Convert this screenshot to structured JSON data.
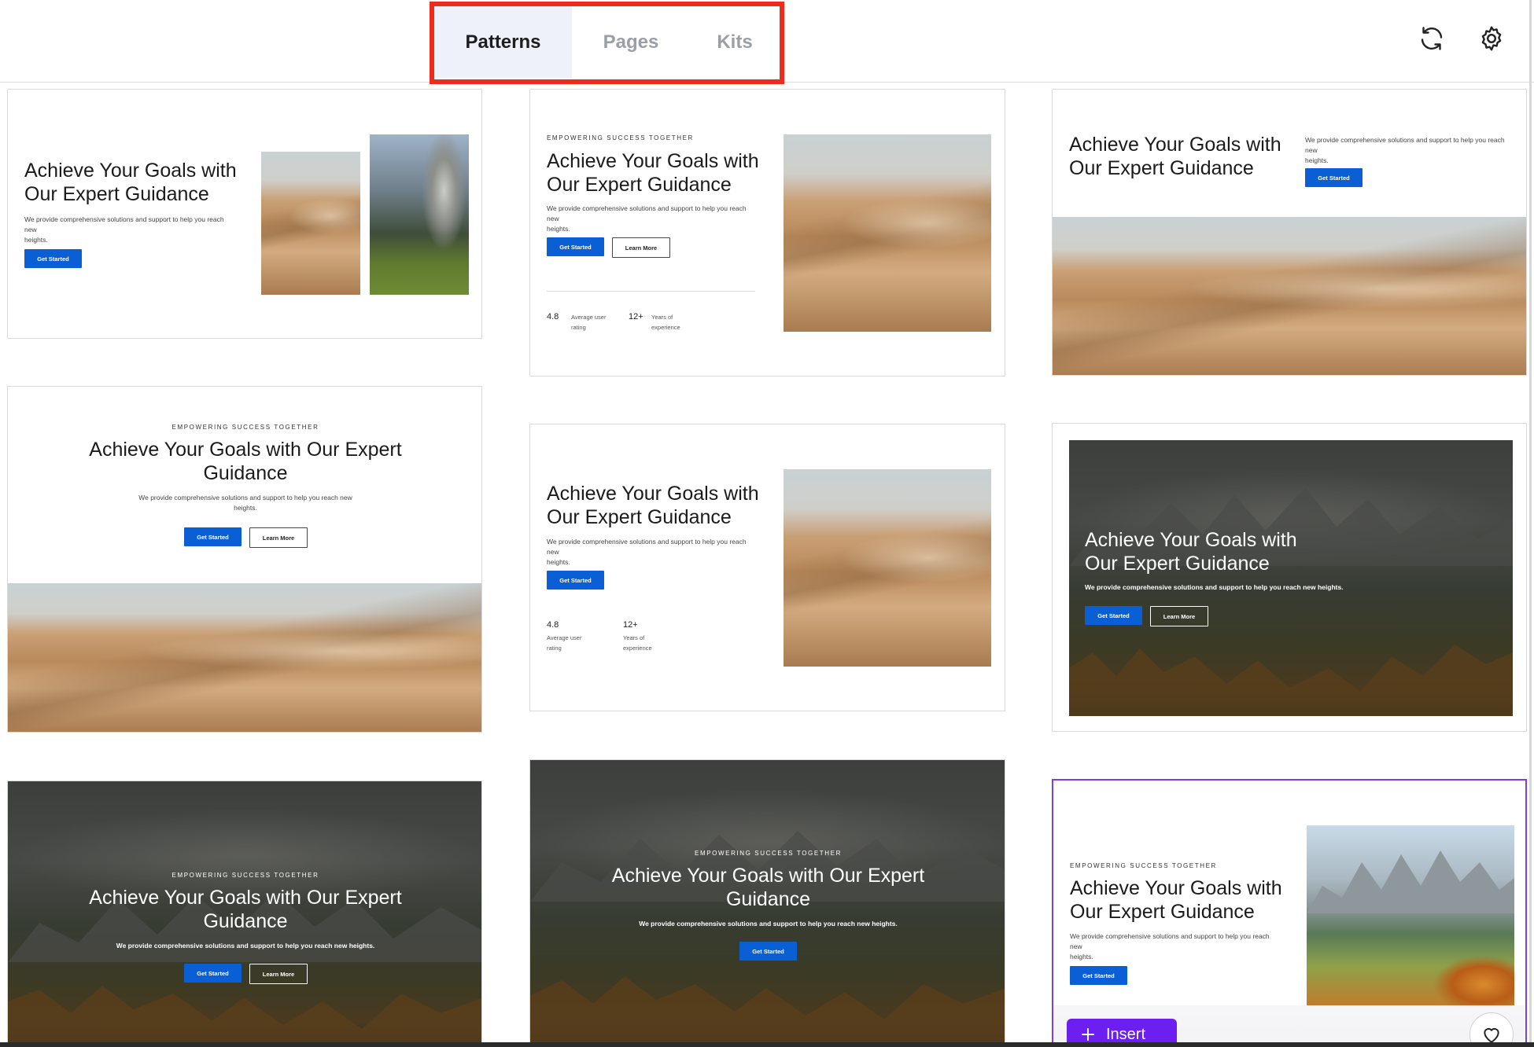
{
  "tabs": [
    {
      "label": "Patterns",
      "active": true
    },
    {
      "label": "Pages",
      "active": false
    },
    {
      "label": "Kits",
      "active": false
    }
  ],
  "header_icons": [
    "refresh-icon",
    "gear-icon"
  ],
  "colors": {
    "tab_highlight": "#ef2b1b",
    "active_tab_bg": "#eef0fa",
    "primary_button": "#0b5fd4",
    "insert_button": "#6d1ef0",
    "selected_border": "#7b3fe4"
  },
  "patterns": {
    "eyebrow": "EMPOWERING SUCCESS TOGETHER",
    "heading_line1": "Achieve Your Goals with",
    "heading_line2": "Our Expert Guidance",
    "heading_wide1": "Achieve Your Goals with Our Expert",
    "heading_wide2": "Guidance",
    "description_1": "We provide comprehensive solutions and support to help you reach new",
    "description_2": "heights.",
    "description_full": "We provide comprehensive solutions and support to help you reach new heights.",
    "cta_primary": "Get Started",
    "cta_secondary": "Learn More",
    "stat_1_value": "4.8",
    "stat_1_label_1": "Average user",
    "stat_1_label_2": "rating",
    "stat_2_value": "12+",
    "stat_2_label_1": "Years of",
    "stat_2_label_2": "experience"
  },
  "actions": {
    "insert_label": "Insert",
    "insert_icon": "plus-icon",
    "favorite_icon": "heart-icon"
  }
}
